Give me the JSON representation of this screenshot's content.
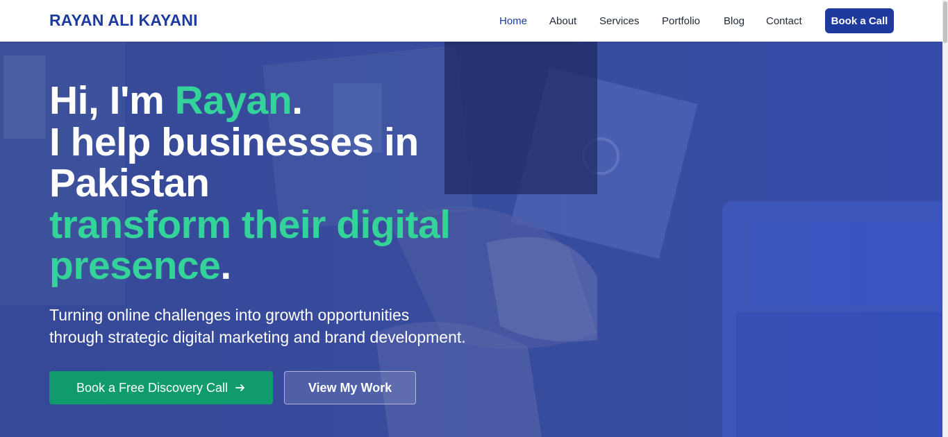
{
  "nav": {
    "brand": "RAYAN ALI KAYANI",
    "items": [
      {
        "label": "Home"
      },
      {
        "label": "About"
      },
      {
        "label": "Services"
      },
      {
        "label": "Portfolio"
      },
      {
        "label": "Blog"
      },
      {
        "label": "Contact"
      }
    ],
    "active": "Home",
    "cta_label": "Book a Call"
  },
  "hero": {
    "headline": {
      "greeting_prefix": "Hi, I'm ",
      "name": "Rayan",
      "period1": ".",
      "line2": "I help businesses in",
      "line3": "Pakistan",
      "line4": "transform their digital",
      "line5_green": "presence",
      "period2": "."
    },
    "subheading_line1": "Turning online challenges into growth opportunities",
    "subheading_line2": "through strategic digital marketing and brand development.",
    "primary_button": "Book a Free Discovery Call",
    "primary_icon": "arrow-right-icon",
    "secondary_button": "View My Work"
  },
  "colors": {
    "brand_blue": "#1e3a9f",
    "accent_green": "#34d399",
    "button_green": "#0f9b6c",
    "hero_blue": "#2f4bb8"
  }
}
